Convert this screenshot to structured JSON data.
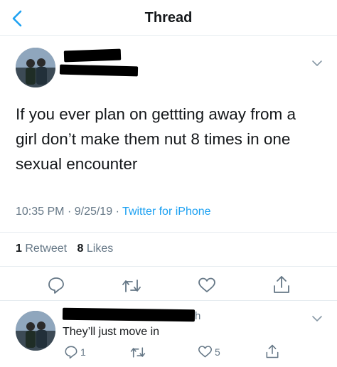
{
  "nav": {
    "title": "Thread"
  },
  "tweet": {
    "text": "If you ever plan on gettting away from a girl don’t make them nut 8 times in one sexual encounter",
    "time": "10:35 PM",
    "date": "9/25/19",
    "separator": "·",
    "client": "Twitter for iPhone",
    "retweets_count": "1",
    "retweets_label": "Retweet",
    "likes_count": "8",
    "likes_label": "Likes"
  },
  "reply": {
    "text": "They’ll just move in",
    "name_tail": "h",
    "reply_count": "1",
    "like_count": "5"
  },
  "colors": {
    "accent": "#1da1f2",
    "muted": "#657786",
    "text": "#14171a",
    "divider": "#e6ecf0"
  },
  "icons": [
    "back-chevron-icon",
    "chevron-down-icon",
    "reply-icon",
    "retweet-icon",
    "like-heart-icon",
    "share-icon"
  ]
}
